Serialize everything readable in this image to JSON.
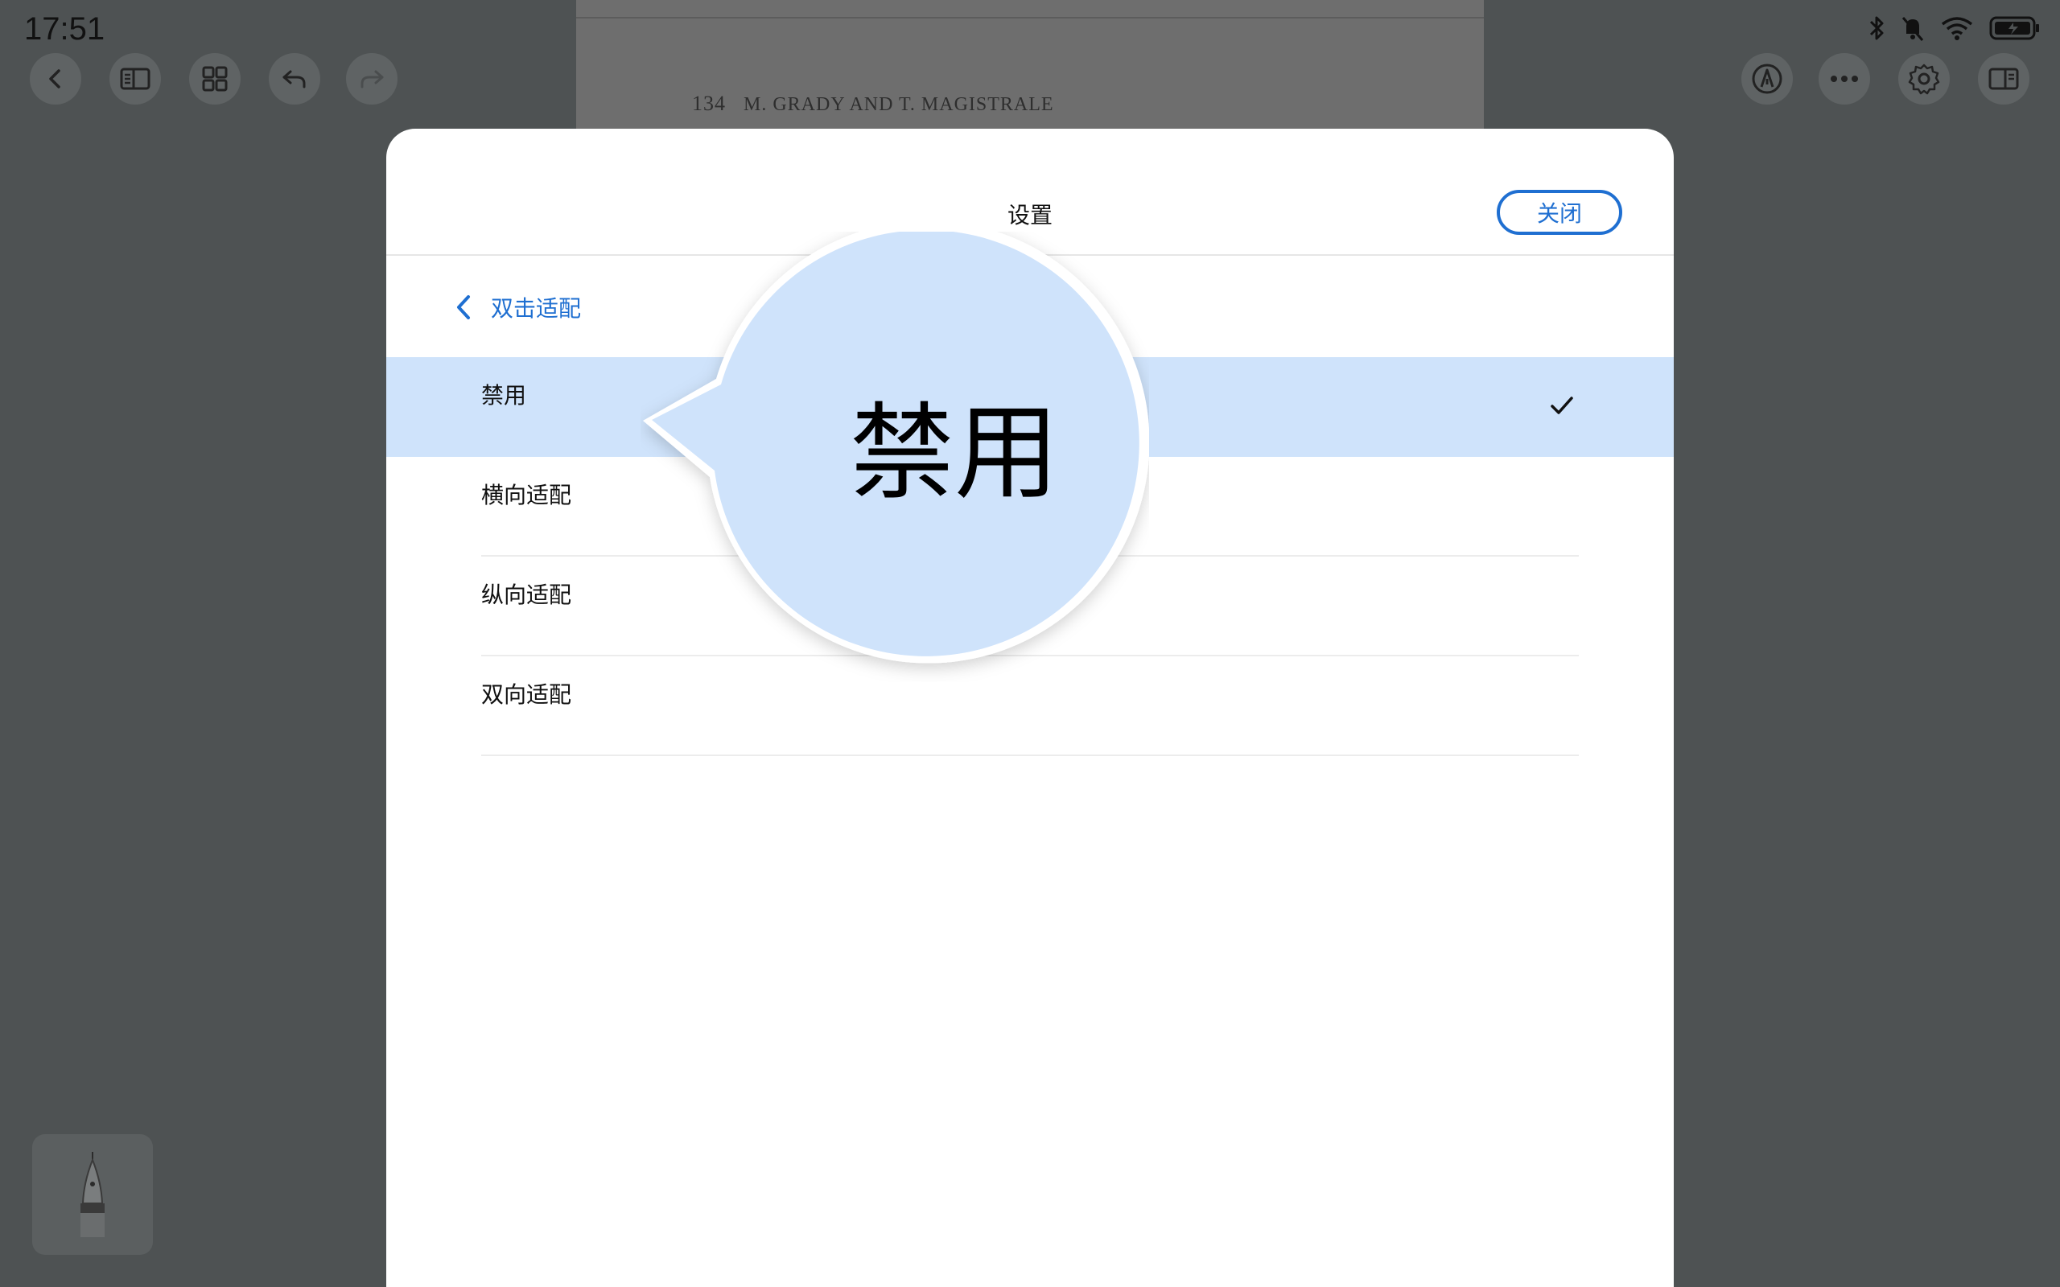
{
  "status_bar": {
    "time": "17:51",
    "icons": [
      "bluetooth-icon",
      "mute-icon",
      "wifi-icon",
      "battery-charging-icon"
    ]
  },
  "toolbar": {
    "left": [
      "back-icon",
      "sidebar-icon",
      "grid-icon",
      "undo-icon",
      "redo-icon"
    ],
    "right": [
      "pen-mode-icon",
      "more-icon",
      "gear-icon",
      "panel-icon"
    ]
  },
  "document": {
    "page_number": "134",
    "running_header": "M. GRADY AND T. MAGISTRALE"
  },
  "modal": {
    "title": "设置",
    "close_label": "关闭",
    "back_label": "双击适配",
    "options": [
      {
        "label": "禁用",
        "selected": true
      },
      {
        "label": "横向适配",
        "selected": false
      },
      {
        "label": "纵向适配",
        "selected": false
      },
      {
        "label": "双向适配",
        "selected": false
      }
    ]
  },
  "magnifier": {
    "text": "禁用"
  },
  "colors": {
    "accent": "#1f6fd1",
    "selected_row": "#cfe3fb",
    "overlay": "#4e5253"
  }
}
